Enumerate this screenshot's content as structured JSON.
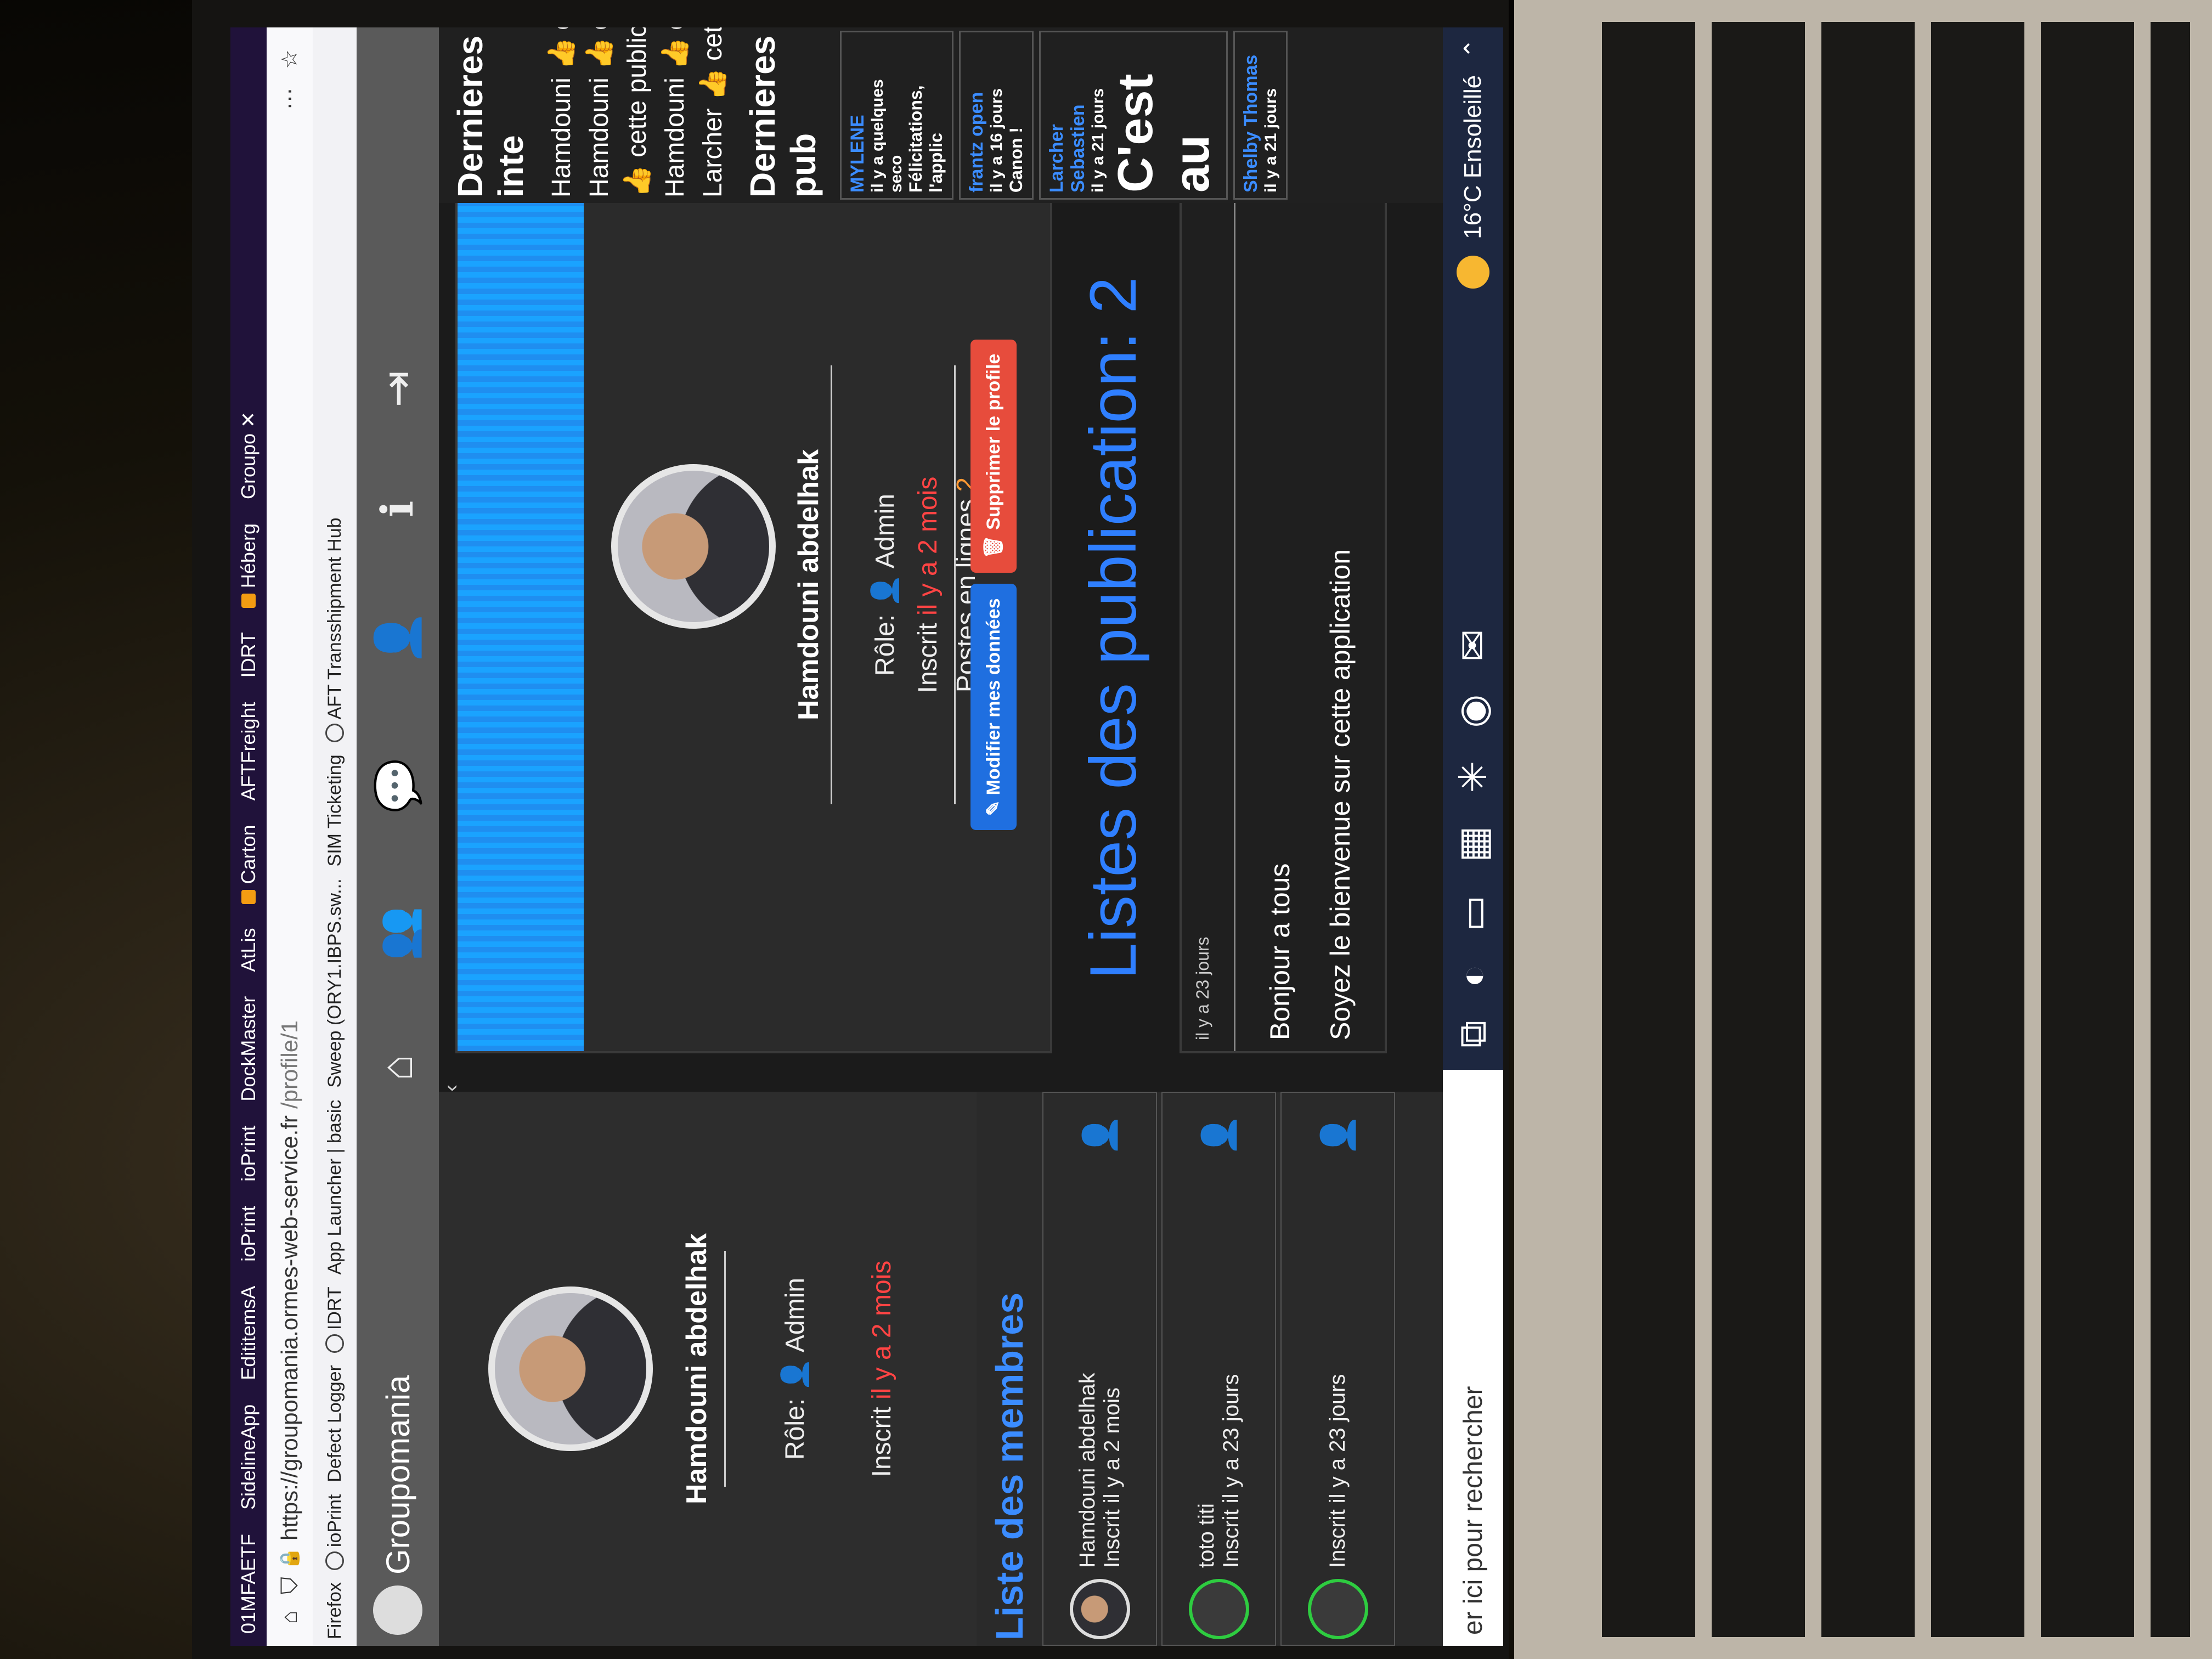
{
  "browser": {
    "tabs": [
      "01MFAETF",
      "SidelineApp",
      "EdititemsA",
      "ioPrint",
      "ioPrint",
      "DockMaster",
      "AtLis",
      "Carton",
      "AFTFreight",
      "IDRT",
      "Héberg",
      "Groupo"
    ],
    "url_host": "https://groupomania.ormes-web-service.fr",
    "url_path": "/profile/1",
    "bookmarks": [
      "Firefox",
      "ioPrint",
      "Defect Logger",
      "IDRT",
      "App Launcher | basic",
      "Sweep (ORY1.IBPS.sw...",
      "SIM Ticketing",
      "AFT Transshipment Hub"
    ]
  },
  "app": {
    "brand": "Groupomania",
    "nav_icons": [
      "home-icon",
      "users-icon",
      "chat-icon",
      "user-icon",
      "info-icon",
      "logout-icon"
    ]
  },
  "sidebar": {
    "name": "Hamdouni abdelhak",
    "role_label": "Rôle:",
    "role": "Admin",
    "joined_label": "Inscrit",
    "joined_value": "il y a 2 mois",
    "members_title": "Liste des membres",
    "members": [
      {
        "name": "Hamdouni abdelhak",
        "joined": "Inscrit il y a 2 mois"
      },
      {
        "name": "toto titi",
        "joined": "Inscrit il y a 23 jours"
      },
      {
        "name": "",
        "joined": "Inscrit il y a 23 jours"
      }
    ]
  },
  "profile": {
    "name": "Hamdouni abdelhak",
    "role_label": "Rôle:",
    "role": "Admin",
    "joined_label": "Inscrit",
    "joined_value": "il y a 2 mois",
    "posts_label": "Postes en lignes",
    "posts_count": "2",
    "edit_button": "Modifier mes données",
    "delete_button": "Supprimer le profile"
  },
  "publications": {
    "title": "Listes des publication: 2",
    "post": {
      "date": "il y a 23 jours",
      "title": "Bonjour a tous",
      "body": "Soyez le bienvenue sur cette application"
    }
  },
  "right_column": {
    "interactions_title": "Dernieres inte",
    "interactions": [
      "Hamdouni 👍 cet",
      "Hamdouni 👍 cet",
      "👍 cette publicati",
      "Hamdouni 👍 cet",
      "Larcher 👍 cette p"
    ],
    "publications_title": "Dernieres pub",
    "pubs": [
      {
        "author": "MYLENE",
        "meta": "il y a quelques seco",
        "text": "Félicitations, l'applic"
      },
      {
        "author": "frantz open",
        "meta": "il y a 16 jours",
        "text": "Canon !"
      },
      {
        "author": "Larcher Sebastien",
        "meta": "il y a 21 jours",
        "text": "C'est au"
      },
      {
        "author": "Shelby Thomas",
        "meta": "il y a 21 jours",
        "text": ""
      }
    ]
  },
  "taskbar": {
    "search_placeholder": "er ici pour rechercher",
    "weather": "16°C  Ensoleillé"
  }
}
